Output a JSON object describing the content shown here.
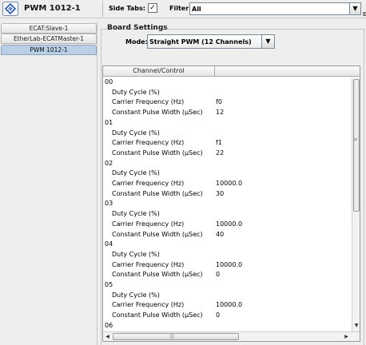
{
  "app": {
    "title": "PWM 1012-1",
    "logo_icon": "ethercat-logo-icon"
  },
  "toolbar": {
    "side_tabs_label": "Side Tabs:",
    "side_tabs_checked": true,
    "side_tabs_mark": "✓",
    "filter_label": "Filter:",
    "filter_value": "All",
    "dropdown_arrow": "▼",
    "edge_text": "E"
  },
  "sidebar": {
    "items": [
      {
        "label": "ECAT:Slave-1",
        "selected": false
      },
      {
        "label": "EtherLab-ECATMaster-1",
        "selected": false
      },
      {
        "label": "PWM 1012-1",
        "selected": true
      }
    ]
  },
  "board": {
    "title": "Board Settings",
    "mode_label": "Mode:",
    "mode_value": "Straight PWM (12 Channels)",
    "dropdown_arrow": "▼"
  },
  "table": {
    "columns": [
      "Channel/Control",
      ""
    ],
    "rows": [
      {
        "kind": "channel",
        "label": "00",
        "value": ""
      },
      {
        "kind": "param",
        "label": "Duty Cycle (%)",
        "value": ""
      },
      {
        "kind": "param",
        "label": "Carrier Frequency (Hz)",
        "value": "f0"
      },
      {
        "kind": "param",
        "label": "Constant Pulse Width (µSec)",
        "value": "12"
      },
      {
        "kind": "channel",
        "label": "01",
        "value": ""
      },
      {
        "kind": "param",
        "label": "Duty Cycle (%)",
        "value": ""
      },
      {
        "kind": "param",
        "label": "Carrier Frequency (Hz)",
        "value": "f1"
      },
      {
        "kind": "param",
        "label": "Constant Pulse Width (µSec)",
        "value": "22"
      },
      {
        "kind": "channel",
        "label": "02",
        "value": ""
      },
      {
        "kind": "param",
        "label": "Duty Cycle (%)",
        "value": ""
      },
      {
        "kind": "param",
        "label": "Carrier Frequency (Hz)",
        "value": "10000.0"
      },
      {
        "kind": "param",
        "label": "Constant Pulse Width (µSec)",
        "value": "30"
      },
      {
        "kind": "channel",
        "label": "03",
        "value": ""
      },
      {
        "kind": "param",
        "label": "Duty Cycle (%)",
        "value": ""
      },
      {
        "kind": "param",
        "label": "Carrier Frequency (Hz)",
        "value": "10000.0"
      },
      {
        "kind": "param",
        "label": "Constant Pulse Width (µSec)",
        "value": "40"
      },
      {
        "kind": "channel",
        "label": "04",
        "value": ""
      },
      {
        "kind": "param",
        "label": "Duty Cycle (%)",
        "value": ""
      },
      {
        "kind": "param",
        "label": "Carrier Frequency (Hz)",
        "value": "10000.0"
      },
      {
        "kind": "param",
        "label": "Constant Pulse Width (µSec)",
        "value": "0"
      },
      {
        "kind": "channel",
        "label": "05",
        "value": ""
      },
      {
        "kind": "param",
        "label": "Duty Cycle (%)",
        "value": ""
      },
      {
        "kind": "param",
        "label": "Carrier Frequency (Hz)",
        "value": "10000.0"
      },
      {
        "kind": "param",
        "label": "Constant Pulse Width (µSec)",
        "value": "0"
      },
      {
        "kind": "channel",
        "label": "06",
        "value": ""
      }
    ]
  },
  "scrollbars": {
    "grip": "≡",
    "h_grip": "|||",
    "down_arrow": "▼",
    "left_arrow": "◀",
    "right_arrow": "▶"
  }
}
